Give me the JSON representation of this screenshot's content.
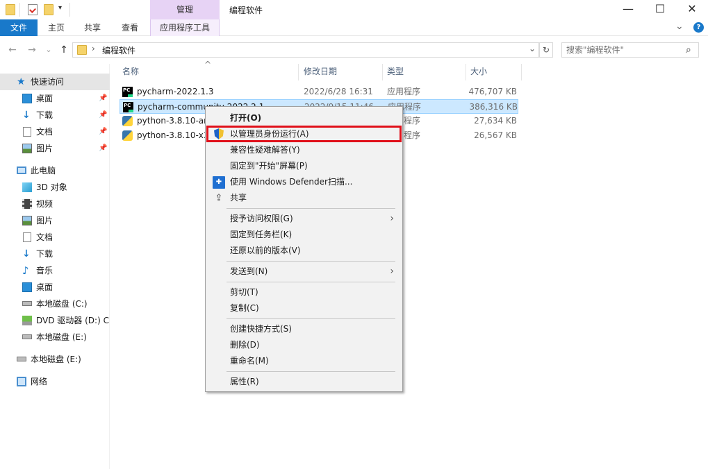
{
  "window": {
    "title": "编程软件",
    "contextual_tab": "管理",
    "controls": {
      "minimize": "—",
      "maximize": "☐",
      "close": "✕"
    }
  },
  "ribbon": {
    "tabs": [
      {
        "label": "文件"
      },
      {
        "label": "主页"
      },
      {
        "label": "共享"
      },
      {
        "label": "查看"
      },
      {
        "label": "应用程序工具"
      }
    ],
    "expand_icon": "⌄",
    "help_icon": "?"
  },
  "address": {
    "path": "编程软件",
    "back": "←",
    "forward": "→",
    "recent": "⌄",
    "up": "↑",
    "separator": "›",
    "dropdown": "⌄",
    "refresh": "↻",
    "search_placeholder": "搜索\"编程软件\"",
    "search_icon": "⌕"
  },
  "nav": {
    "items": [
      {
        "label": "快速访问",
        "icon": "star-icon"
      },
      {
        "label": "桌面",
        "icon": "desktop-icon",
        "pinned": true
      },
      {
        "label": "下载",
        "icon": "download-icon",
        "pinned": true
      },
      {
        "label": "文档",
        "icon": "document-icon",
        "pinned": true
      },
      {
        "label": "图片",
        "icon": "picture-icon",
        "pinned": true
      },
      {
        "label": "此电脑",
        "icon": "computer-icon"
      },
      {
        "label": "3D 对象",
        "icon": "cube-icon"
      },
      {
        "label": "视频",
        "icon": "video-icon"
      },
      {
        "label": "图片",
        "icon": "picture-icon"
      },
      {
        "label": "文档",
        "icon": "document-icon"
      },
      {
        "label": "下载",
        "icon": "download-icon"
      },
      {
        "label": "音乐",
        "icon": "music-icon"
      },
      {
        "label": "桌面",
        "icon": "desktop-icon"
      },
      {
        "label": "本地磁盘 (C:)",
        "icon": "drive-icon"
      },
      {
        "label": "DVD 驱动器 (D:) C",
        "icon": "dvd-icon"
      },
      {
        "label": "本地磁盘 (E:)",
        "icon": "drive-icon"
      },
      {
        "label": "本地磁盘 (E:)",
        "icon": "drive-icon"
      },
      {
        "label": "网络",
        "icon": "network-icon"
      }
    ],
    "pin_glyph": "📌"
  },
  "columns": {
    "name": "名称",
    "date": "修改日期",
    "type": "类型",
    "size": "大小"
  },
  "sort_indicator": "^",
  "files": [
    {
      "name": "pycharm-2022.1.3",
      "date": "2022/6/28 16:31",
      "type": "应用程序",
      "size": "476,707 KB",
      "icon": "pycharm-icon"
    },
    {
      "name": "pycharm-community-2022.2.1",
      "date": "2022/9/15 11:46",
      "type": "应用程序",
      "size": "386,316 KB",
      "icon": "pycharm-icon"
    },
    {
      "name": "python-3.8.10-amd64",
      "date": "",
      "type": "应用程序",
      "size": "27,634 KB",
      "icon": "python-icon"
    },
    {
      "name": "python-3.8.10-x32",
      "date": "",
      "type": "应用程序",
      "size": "26,567 KB",
      "icon": "python-icon"
    }
  ],
  "context_menu": {
    "items": [
      {
        "label": "打开(O)",
        "bold": true
      },
      {
        "label": "以管理员身份运行(A)",
        "icon": "uac-shield-icon"
      },
      {
        "label": "兼容性疑难解答(Y)"
      },
      {
        "label": "固定到\"开始\"屏幕(P)"
      },
      {
        "label": "使用 Windows Defender扫描...",
        "icon": "defender-icon"
      },
      {
        "label": "共享",
        "icon": "share-icon"
      },
      {
        "label": "授予访问权限(G)",
        "submenu": true
      },
      {
        "label": "固定到任务栏(K)"
      },
      {
        "label": "还原以前的版本(V)"
      },
      {
        "label": "发送到(N)",
        "submenu": true
      },
      {
        "label": "剪切(T)"
      },
      {
        "label": "复制(C)"
      },
      {
        "label": "创建快捷方式(S)"
      },
      {
        "label": "删除(D)"
      },
      {
        "label": "重命名(M)"
      },
      {
        "label": "属性(R)"
      }
    ],
    "submenu_arrow": "›",
    "share_glyph": "⇪",
    "defender_glyph": "✚"
  },
  "colors": {
    "accent": "#1979ca",
    "selection": "#cce8ff",
    "highlight_border": "#e0101a",
    "contextual_tab": "#e7d3f5"
  }
}
